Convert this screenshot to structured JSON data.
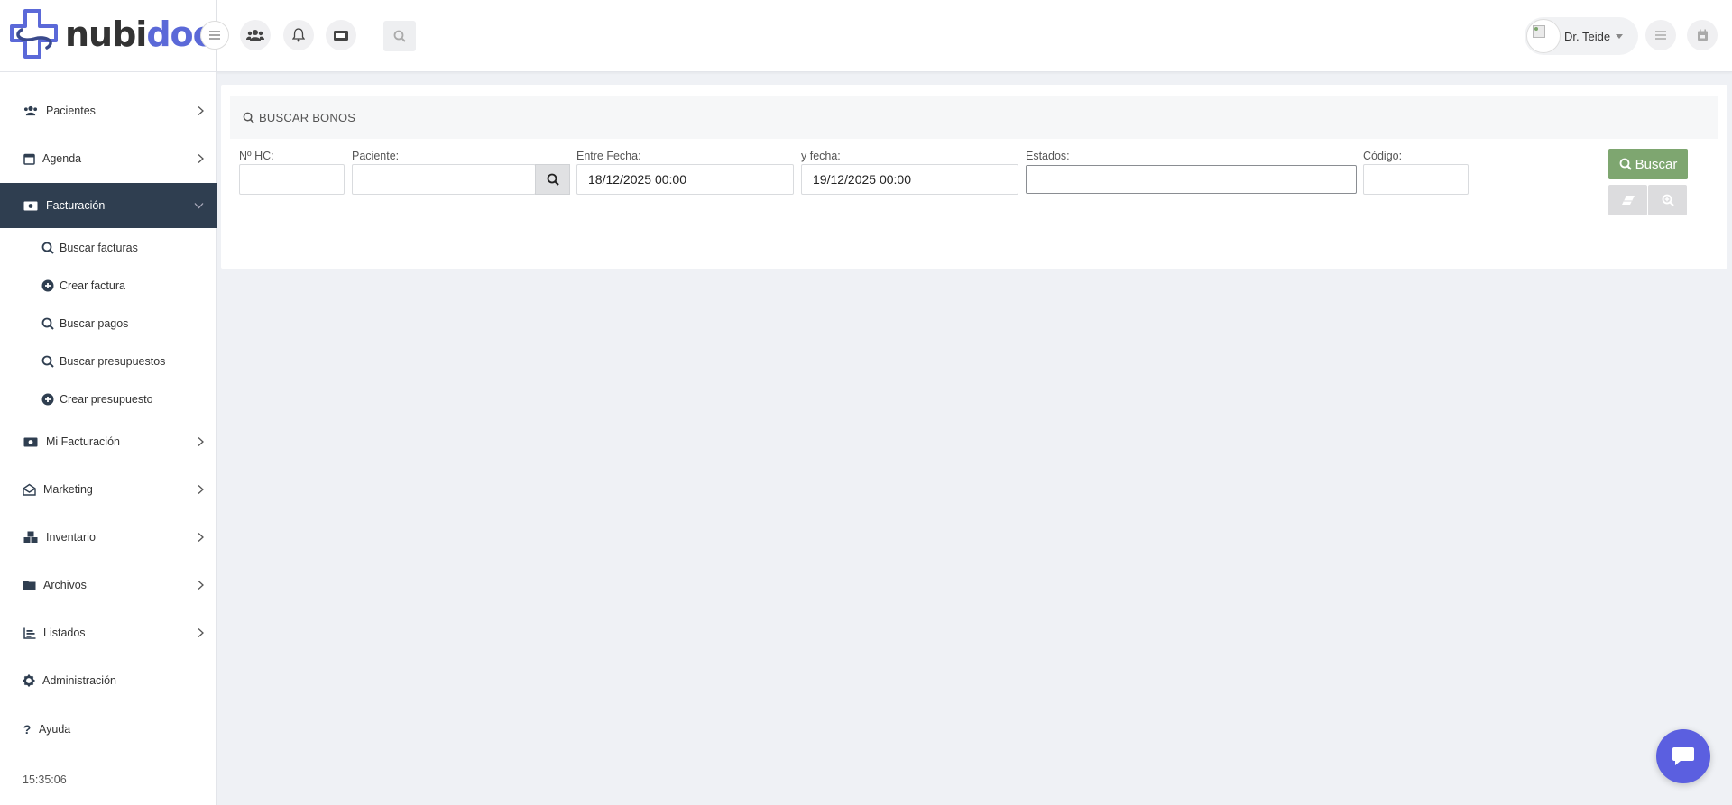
{
  "app": {
    "logo_part1": "nubi",
    "logo_part2": "doc",
    "brand_color": "#5b69d8"
  },
  "header": {
    "user_name": "Dr. Teide",
    "icons": [
      "menu-icon",
      "users-icon",
      "bell-icon",
      "ticket-icon",
      "search-icon",
      "list-icon",
      "calendar-icon"
    ]
  },
  "sidebar": {
    "items": [
      {
        "label": "Pacientes",
        "icon": "users-icon"
      },
      {
        "label": "Agenda",
        "icon": "calendar-icon"
      },
      {
        "label": "Facturación",
        "icon": "money-icon",
        "active": true
      },
      {
        "label": "Mi Facturación",
        "icon": "money-icon"
      },
      {
        "label": "Marketing",
        "icon": "envelope-open-icon"
      },
      {
        "label": "Inventario",
        "icon": "cubes-icon"
      },
      {
        "label": "Archivos",
        "icon": "folder-icon"
      },
      {
        "label": "Listados",
        "icon": "chart-icon"
      },
      {
        "label": "Administración",
        "icon": "gear-icon"
      },
      {
        "label": "Ayuda",
        "icon": "question-icon"
      }
    ],
    "subitems": [
      {
        "label": "Buscar facturas",
        "icon": "search-icon"
      },
      {
        "label": "Crear factura",
        "icon": "plus-circle-icon"
      },
      {
        "label": "Buscar pagos",
        "icon": "search-icon"
      },
      {
        "label": "Buscar presupuestos",
        "icon": "search-icon"
      },
      {
        "label": "Crear presupuesto",
        "icon": "plus-circle-icon"
      }
    ],
    "clock": "15:35:06",
    "active_color": "#2f3e50"
  },
  "panel": {
    "title": "BUSCAR BONOS",
    "fields": {
      "hc": {
        "label": "Nº HC:",
        "value": ""
      },
      "paciente": {
        "label": "Paciente:",
        "value": ""
      },
      "fecha_desde": {
        "label": "Entre Fecha:",
        "value": "18/12/2025 00:00"
      },
      "fecha_hasta": {
        "label": "y fecha:",
        "value": "19/12/2025 00:00"
      },
      "estados": {
        "label": "Estados:",
        "value": ""
      },
      "codigo": {
        "label": "Código:",
        "value": ""
      }
    },
    "buscar_label": "Buscar",
    "buscar_color": "#7ea670"
  }
}
